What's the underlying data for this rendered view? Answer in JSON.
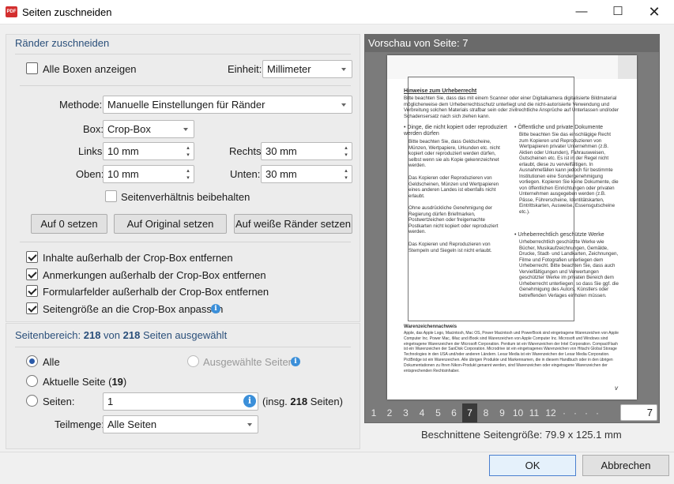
{
  "window": {
    "title": "Seiten zuschneiden",
    "icon_label": "PDF"
  },
  "margins": {
    "heading": "Ränder zuschneiden",
    "show_all_boxes": "Alle Boxen anzeigen",
    "unit_label": "Einheit:",
    "unit_value": "Millimeter",
    "method_label": "Methode:",
    "method_value": "Manuelle Einstellungen für Ränder",
    "box_label": "Box:",
    "box_value": "Crop-Box",
    "left_label": "Links:",
    "left_value": "10 mm",
    "right_label": "Rechts:",
    "right_value": "30 mm",
    "top_label": "Oben:",
    "top_value": "10 mm",
    "bottom_label": "Unten:",
    "bottom_value": "30 mm",
    "keep_ratio": "Seitenverhältnis beibehalten",
    "btn_zero": "Auf 0 setzen",
    "btn_original": "Auf Original setzen",
    "btn_white": "Auf weiße Ränder setzen",
    "opt1": "Inhalte außerhalb der Crop-Box entfernen",
    "opt2": "Anmerkungen außerhalb der Crop-Box entfernen",
    "opt3": "Formularfelder außerhalb der Crop-Box entfernen",
    "opt4": "Seitengröße an die Crop-Box anpassen"
  },
  "range": {
    "heading_pre": "Seitenbereich: ",
    "heading_sel": "218",
    "heading_mid": " von ",
    "heading_total": "218",
    "heading_post": " Seiten ausgewählt",
    "all": "Alle",
    "selected": "Ausgewählte Seiten",
    "current_pre": "Aktuelle Seite (",
    "current_num": "19",
    "current_post": ")",
    "pages_label": "Seiten:",
    "pages_value": "1",
    "incl_pre": "(insg. ",
    "incl_num": "218",
    "incl_post": " Seiten)",
    "subset_label": "Teilmenge:",
    "subset_value": "Alle Seiten"
  },
  "preview": {
    "heading": "Vorschau von Seite: 7",
    "pages": [
      "1",
      "2",
      "3",
      "4",
      "5",
      "6",
      "7",
      "8",
      "9",
      "10",
      "11",
      "12"
    ],
    "current_page": "7",
    "page_input": "7",
    "nav_dots": "·   ·   ·   ·",
    "crop_size": "Beschnittene Seitengröße: 79.9 x 125.1 mm",
    "doc": {
      "h1": "Hinweise zum Urheberrecht",
      "p1": "Bitte beachten Sie, dass das mit einem Scanner oder einer Digitalkamera digitalisierte Bildmaterial möglicherweise dem Urheberrechtsschutz unterliegt und die nicht-autorisierte Verwendung und Verbreitung solchen Materials strafbar sein oder zivilrechtliche Ansprüche auf Unterlassen und/oder Schadensersatz nach sich ziehen kann.",
      "b1": "• Dinge, die nicht kopiert oder reproduziert werden dürfen",
      "c1": "Bitte beachten Sie, dass Geldscheine, Münzen, Wertpapiere, Urkunden etc. nicht kopiert oder reproduziert werden dürfen, selbst wenn sie als Kopie gekennzeichnet werden.",
      "c2": "Das Kopieren oder Reproduzieren von Geldscheinen, Münzen und Wertpapieren eines anderen Landes ist ebenfalls nicht erlaubt.",
      "c3": "Ohne ausdrückliche Genehmigung der Regierung dürfen Briefmarken, Postwertzeichen oder freigemachte Postkarten nicht kopiert oder reproduziert werden.",
      "c4": "Das Kopieren und Reproduzieren von Stempeln und Siegeln ist nicht erlaubt.",
      "b2": "• Öffentliche und private Dokumente",
      "d1": "Bitte beachten Sie das einschlägige Recht zum Kopieren und Reproduzieren von Wertpapieren privater Unternehmen (z.B. Aktien oder Urkunden), Fahrausweisen, Gutscheinen etc. Es ist in der Regel nicht erlaubt, diese zu vervielfältigen. In Ausnahmefällen kann jedoch für bestimmte Institutionen eine Sondergenehmigung vorliegen. Kopieren Sie keine Dokumente, die von öffentlichen Einrichtungen oder privaten Unternehmen ausgegeben werden (z.B. Pässe, Führerscheine, Identitätskarten, Eintrittskarten, Ausweise, Essensgutscheine etc.).",
      "b3": "• Urheberrechtlich geschützte Werke",
      "d2": "Urheberrechtlich geschützte Werke wie Bücher, Musikaufzeichnungen, Gemälde, Drucke, Stadt- und Landkarten, Zeichnungen, Filme und Fotografien unterliegen dem Urheberrecht. Bitte beachten Sie, dass auch Vervielfältigungen und Verwertungen geschützter Werke im privaten Bereich dem Urheberrecht unterliegen, so dass Sie ggf. die Genehmigung des Autors, Künstlers oder betreffenden Verlages einholen müssen.",
      "h2": "Warenzeichennachweis",
      "p2": "Apple, das Apple Logo, Macintosh, Mac OS, Power Macintosh und PowerBook sind eingetragene Warenzeichen von Apple Computer Inc. Power Mac, iMac und iBook sind Warenzeichen von Apple Computer Inc. Microsoft und Windows sind eingetragene Warenzeichen der Microsoft Corporation. Pentium ist ein Warenzeichen der Intel Corporation. CompactFlash ist ein Warenzeichen der SanDisk Corporation. Microdrive ist ein eingetragenes Warenzeichen von Hitachi Global Storage Technologies in den USA und/oder anderen Ländern. Lexar Media ist ein Warenzeichen der Lexar Media Corporation. PictBridge ist ein Warenzeichen. Alle übrigen Produkte und Markennamen, die in diesem Handbuch oder in den übrigen Dokumentationen zu Ihren Nikon-Produkt genannt werden, sind Warenzeichen oder eingetragene Warenzeichen der entsprechenden Rechtsinhaber.",
      "pno": "v"
    }
  },
  "footer": {
    "ok": "OK",
    "cancel": "Abbrechen"
  },
  "colors": {
    "accent": "#2a5aa8",
    "heading": "#2a4f7a",
    "info": "#3b8fd9",
    "brand": "#d32f2f"
  }
}
